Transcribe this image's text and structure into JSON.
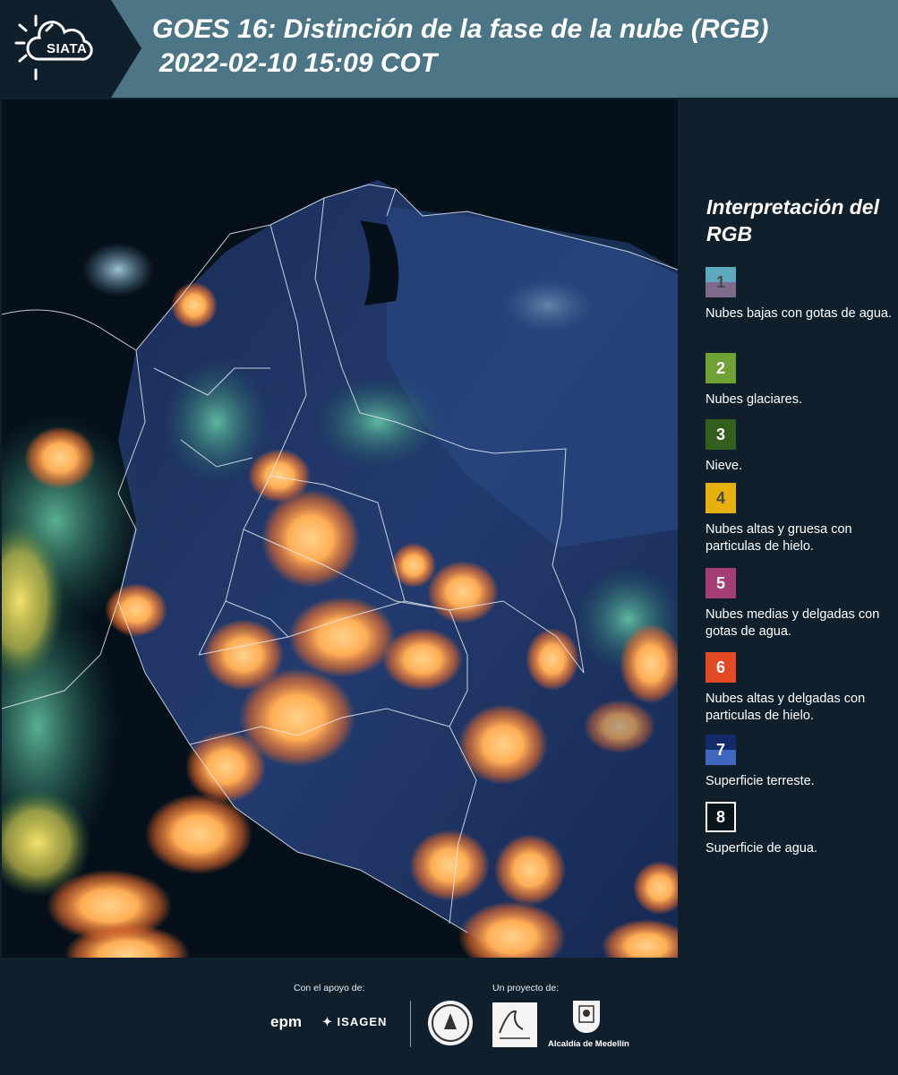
{
  "header": {
    "logo_text": "SIATA",
    "title_line1": "GOES 16: Distinción de la fase de la nube (RGB)",
    "title_line2": "2022-02-10 15:09 COT"
  },
  "legend": {
    "title": "Interpretación del RGB",
    "items": [
      {
        "number": "1",
        "label": "Nubes bajas con gotas de agua.",
        "color_top": "#5fa9bd",
        "color_bottom": "#7e6a8a",
        "number_color": "#4a4a4a"
      },
      {
        "number": "2",
        "label": "Nubes glaciares.",
        "color_top": "#6fa235",
        "color_bottom": "#6fa235",
        "number_color": "#ffffff"
      },
      {
        "number": "3",
        "label": "Nieve.",
        "color_top": "#335f1d",
        "color_bottom": "#335f1d",
        "number_color": "#ffffff"
      },
      {
        "number": "4",
        "label": "Nubes altas y gruesa con particulas de hielo.",
        "color_top": "#e7b00f",
        "color_bottom": "#e7b00f",
        "number_color": "#4a4a4a"
      },
      {
        "number": "5",
        "label": "Nubes medias y delgadas con gotas de agua.",
        "color_top": "#a43f76",
        "color_bottom": "#a43f76",
        "number_color": "#ffffff"
      },
      {
        "number": "6",
        "label": "Nubes altas y delgadas con particulas de hielo.",
        "color_top": "#e24924",
        "color_bottom": "#e24924",
        "number_color": "#ffffff"
      },
      {
        "number": "7",
        "label": "Superficie terreste.",
        "color_top": "#132a6a",
        "color_bottom": "#3f67c0",
        "number_color": "#ffffff"
      },
      {
        "number": "8",
        "label": "Superficie de agua.",
        "color_top": "#07141a",
        "color_bottom": "#07141a",
        "number_color": "#ffffff",
        "border": "#ffffff"
      }
    ]
  },
  "footer": {
    "support_caption": "Con el apoyo de:",
    "project_caption": "Un proyecto de:",
    "epm": "epm",
    "isagen": "ISAGEN",
    "alcaldia": "Alcaldía de Medellín"
  }
}
